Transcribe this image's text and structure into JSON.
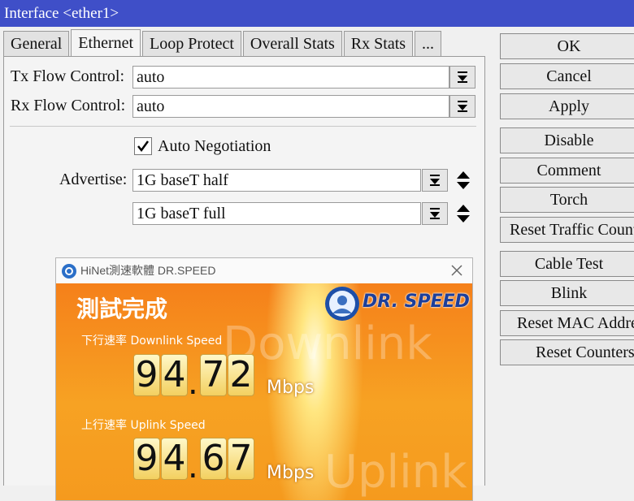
{
  "window": {
    "title": "Interface <ether1>"
  },
  "tabs": [
    "General",
    "Ethernet",
    "Loop Protect",
    "Overall Stats",
    "Rx Stats",
    "..."
  ],
  "form": {
    "tx_flow_label": "Tx Flow Control:",
    "tx_flow_value": "auto",
    "rx_flow_label": "Rx Flow Control:",
    "rx_flow_value": "auto",
    "auto_negotiation_label": "Auto Negotiation",
    "auto_negotiation_checked": true,
    "advertise_label": "Advertise:",
    "advertise_values": [
      "1G baseT half",
      "1G baseT full"
    ]
  },
  "buttons": [
    "OK",
    "Cancel",
    "Apply",
    "Disable",
    "Comment",
    "Torch",
    "Reset Traffic Counters",
    "Cable Test",
    "Blink",
    "Reset MAC Address",
    "Reset Counters"
  ],
  "speedtest": {
    "window_title": "HiNet測速軟體 DR.SPEED",
    "heading": "測試完成",
    "logo_text": "DR. SPEED",
    "downlink_caption": "下行速率 Downlink  Speed",
    "downlink_int": [
      "9",
      "4"
    ],
    "downlink_dec": [
      "7",
      "2"
    ],
    "uplink_caption": "上行速率 Uplink Speed",
    "uplink_int": [
      "9",
      "4"
    ],
    "uplink_dec": [
      "6",
      "7"
    ],
    "unit": "Mbps",
    "bg_word_down": "Downlink",
    "bg_word_up": "Uplink"
  }
}
